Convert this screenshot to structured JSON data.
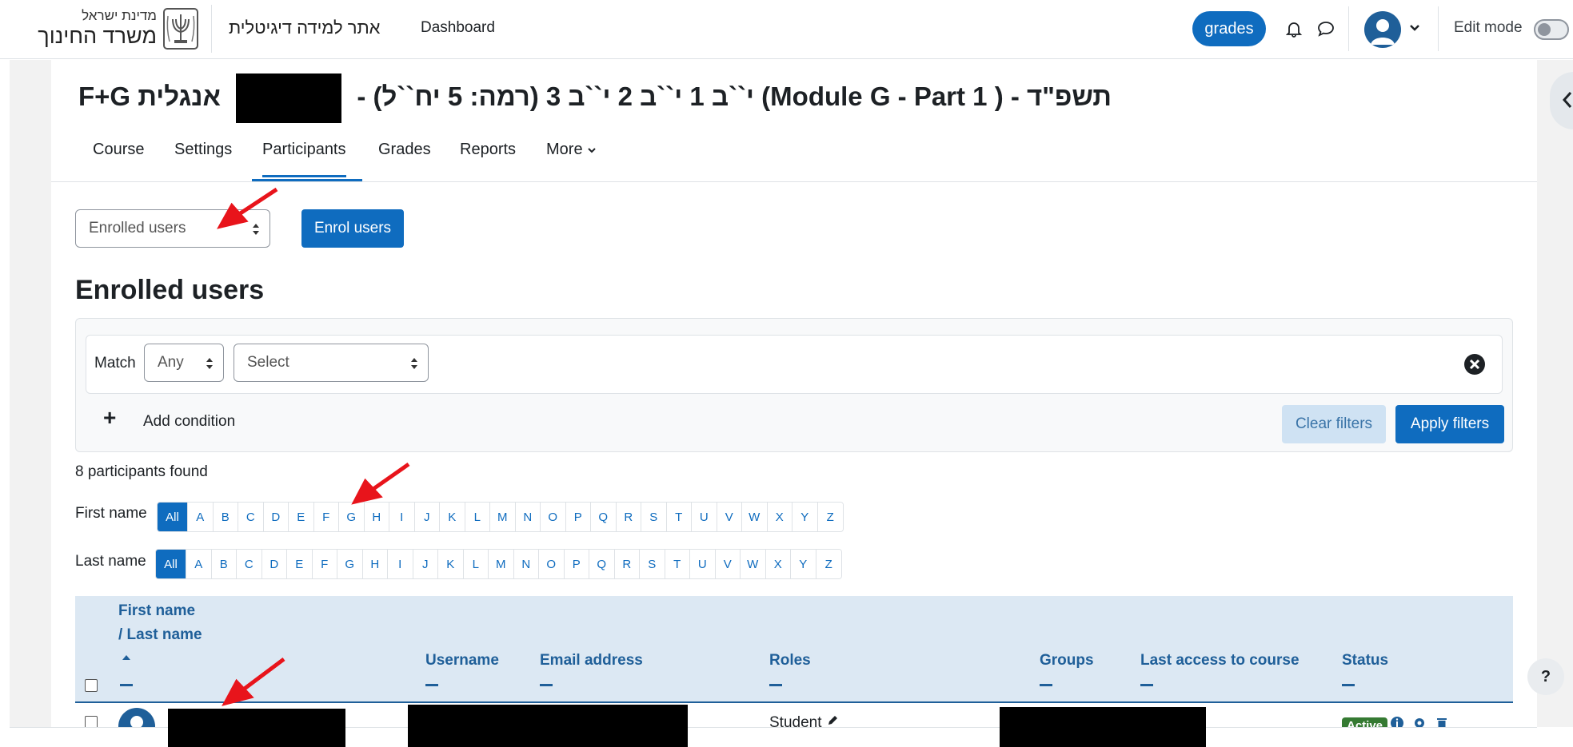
{
  "header": {
    "logo_line1": "מדינת ישראל",
    "logo_line2": "משרד החינוך",
    "site_name": "אתר למידה דיגיטלית",
    "dashboard_link": "Dashboard",
    "grades_button": "grades",
    "edit_mode_label": "Edit mode"
  },
  "course": {
    "title_part1": "תשפ\"ד - ( Module G - Part 1) י``ב 1 י``ב 2 י``ב 3 (רמה: 5 יח``ל) -",
    "title_part2": "אנגלית F+G"
  },
  "secondary_nav": {
    "items": [
      "Course",
      "Settings",
      "Participants",
      "Grades",
      "Reports"
    ],
    "more_label": "More",
    "active": "Participants"
  },
  "controls": {
    "page_select_value": "Enrolled users",
    "enrol_button": "Enrol users",
    "section_heading": "Enrolled users"
  },
  "filters": {
    "match_label": "Match",
    "match_value": "Any",
    "select_value": "Select",
    "add_condition": "Add condition",
    "clear_filters": "Clear filters",
    "apply_filters": "Apply filters"
  },
  "participants": {
    "found_text": "8 participants found",
    "first_name_label": "First name",
    "last_name_label": "Last name",
    "initials": [
      "All",
      "A",
      "B",
      "C",
      "D",
      "E",
      "F",
      "G",
      "H",
      "I",
      "J",
      "K",
      "L",
      "M",
      "N",
      "O",
      "P",
      "Q",
      "R",
      "S",
      "T",
      "U",
      "V",
      "W",
      "X",
      "Y",
      "Z"
    ],
    "selected_initial": "All"
  },
  "table": {
    "col_name_line1": "First name",
    "col_name_line2": "/ Last name",
    "col_username": "Username",
    "col_email": "Email address",
    "col_roles": "Roles",
    "col_groups": "Groups",
    "col_last_access": "Last access to course",
    "col_status": "Status",
    "row1_role": "Student",
    "row1_status": "Active"
  },
  "colors": {
    "primary": "#0f6cbf",
    "header_blue": "#1f5f99",
    "table_head_bg": "#dce8f3",
    "annotation_arrow": "#e8141b"
  },
  "icons": [
    "bell-icon",
    "chat-icon",
    "user-avatar-icon",
    "chevron-down-icon",
    "close-circle-icon",
    "plus-icon",
    "sort-up-icon",
    "info-icon",
    "gear-icon",
    "trash-icon",
    "pencil-icon",
    "help-icon",
    "chevron-left-icon"
  ]
}
